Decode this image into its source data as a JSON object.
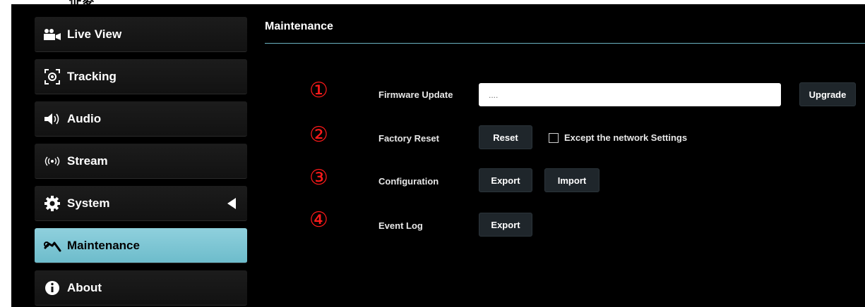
{
  "page": {
    "top_glyph": "佂夌"
  },
  "sidebar": {
    "items": [
      {
        "label": "Live View",
        "icon": "video-camera-icon"
      },
      {
        "label": "Tracking",
        "icon": "tracking-target-icon"
      },
      {
        "label": "Audio",
        "icon": "speaker-icon"
      },
      {
        "label": "Stream",
        "icon": "broadcast-icon"
      },
      {
        "label": "System",
        "icon": "gear-icon"
      },
      {
        "label": "Maintenance",
        "icon": "wrench-icon"
      },
      {
        "label": "About",
        "icon": "info-icon"
      }
    ],
    "active": "Maintenance"
  },
  "main": {
    "title": "Maintenance",
    "annotations": [
      "①",
      "②",
      "③",
      "④"
    ],
    "firmware": {
      "label": "Firmware Update",
      "placeholder": "....",
      "button": "Upgrade"
    },
    "factory_reset": {
      "label": "Factory Reset",
      "button": "Reset",
      "checkbox_label": "Except the network Settings",
      "checked": false
    },
    "configuration": {
      "label": "Configuration",
      "export_button": "Export",
      "import_button": "Import"
    },
    "event_log": {
      "label": "Event Log",
      "export_button": "Export"
    }
  },
  "colors": {
    "accent": "#7fc8d6",
    "annotation": "#ff1a1a",
    "background": "#000000"
  }
}
